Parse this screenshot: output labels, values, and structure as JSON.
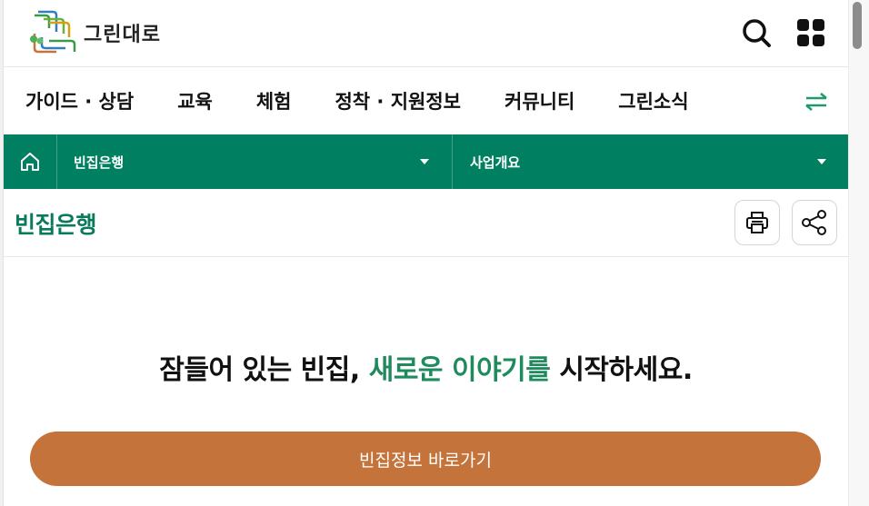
{
  "header": {
    "logo_text": "그린대로",
    "icons": {
      "search": "search-icon",
      "menu": "grid-menu-icon"
    }
  },
  "gnb": {
    "items": [
      "가이드 · 상담",
      "교육",
      "체험",
      "정착 · 지원정보",
      "커뮤니티",
      "그린소식"
    ],
    "toggle_icon": "swap-arrows-icon"
  },
  "location": {
    "home_icon": "home-icon",
    "depth1": "빈집은행",
    "depth2": "사업개요"
  },
  "title_row": {
    "title": "빈집은행",
    "icons": {
      "print": "printer-icon",
      "share": "share-icon"
    }
  },
  "content": {
    "slogan_prefix": "잠들어 있는 빈집, ",
    "slogan_highlight": "새로운 이야기를",
    "slogan_suffix": " 시작하세요.",
    "cta_label": "빈집정보 바로가기"
  },
  "colors": {
    "brand_green": "#008060",
    "title_green": "#0a7a5c",
    "highlight_green": "#1f8a5e",
    "cta_brown": "#c4733a"
  }
}
